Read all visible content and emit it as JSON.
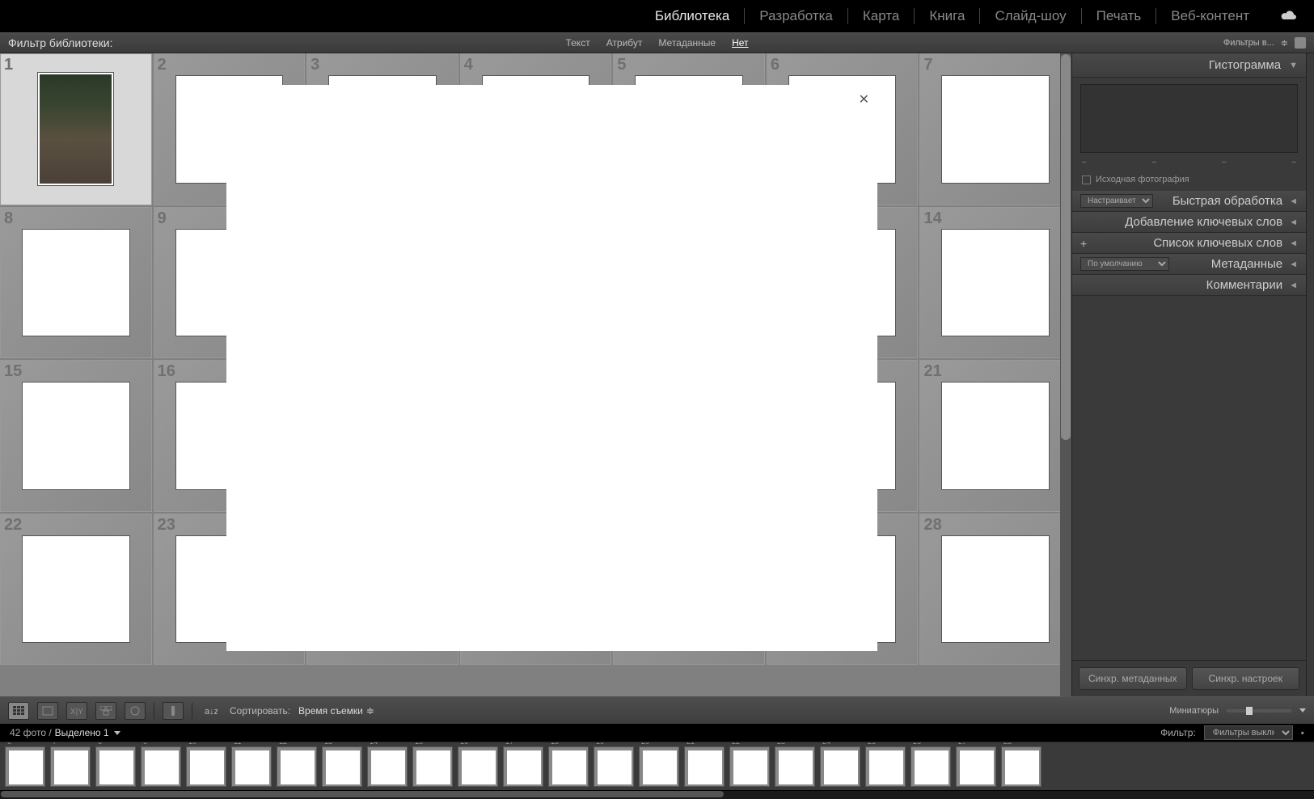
{
  "modules": {
    "library": "Библиотека",
    "develop": "Разработка",
    "map": "Карта",
    "book": "Книга",
    "slideshow": "Слайд-шоу",
    "print": "Печать",
    "web": "Веб-контент"
  },
  "filterBar": {
    "label": "Фильтр библиотеки:",
    "text": "Текст",
    "attribute": "Атрибут",
    "metadata": "Метаданные",
    "none": "Нет",
    "filtersIn": "Фильтры в..."
  },
  "rightPanel": {
    "histogram": "Гистограмма",
    "dash": "–",
    "sourcePhoto": "Исходная фотография",
    "customSelect": "Настраивается",
    "quickDevelop": "Быстрая обработка",
    "keywording": "Добавление ключевых слов",
    "keywordList": "Список ключевых слов",
    "metadata": "Метаданные",
    "defaultSelect": "По умолчанию",
    "comments": "Комментарии",
    "syncMetadata": "Синхр. метаданных",
    "syncSettings": "Синхр. настроек"
  },
  "toolbar": {
    "sortLabel": "Сортировать:",
    "sortValue": "Время съемки",
    "thumbnails": "Миниатюры"
  },
  "statusBar": {
    "photoCount": "42 фото /",
    "selected": "Выделено 1",
    "filterLabel": "Фильтр:",
    "filtersOff": "Фильтры выключ..."
  },
  "filmstrip": {
    "count": 22
  }
}
